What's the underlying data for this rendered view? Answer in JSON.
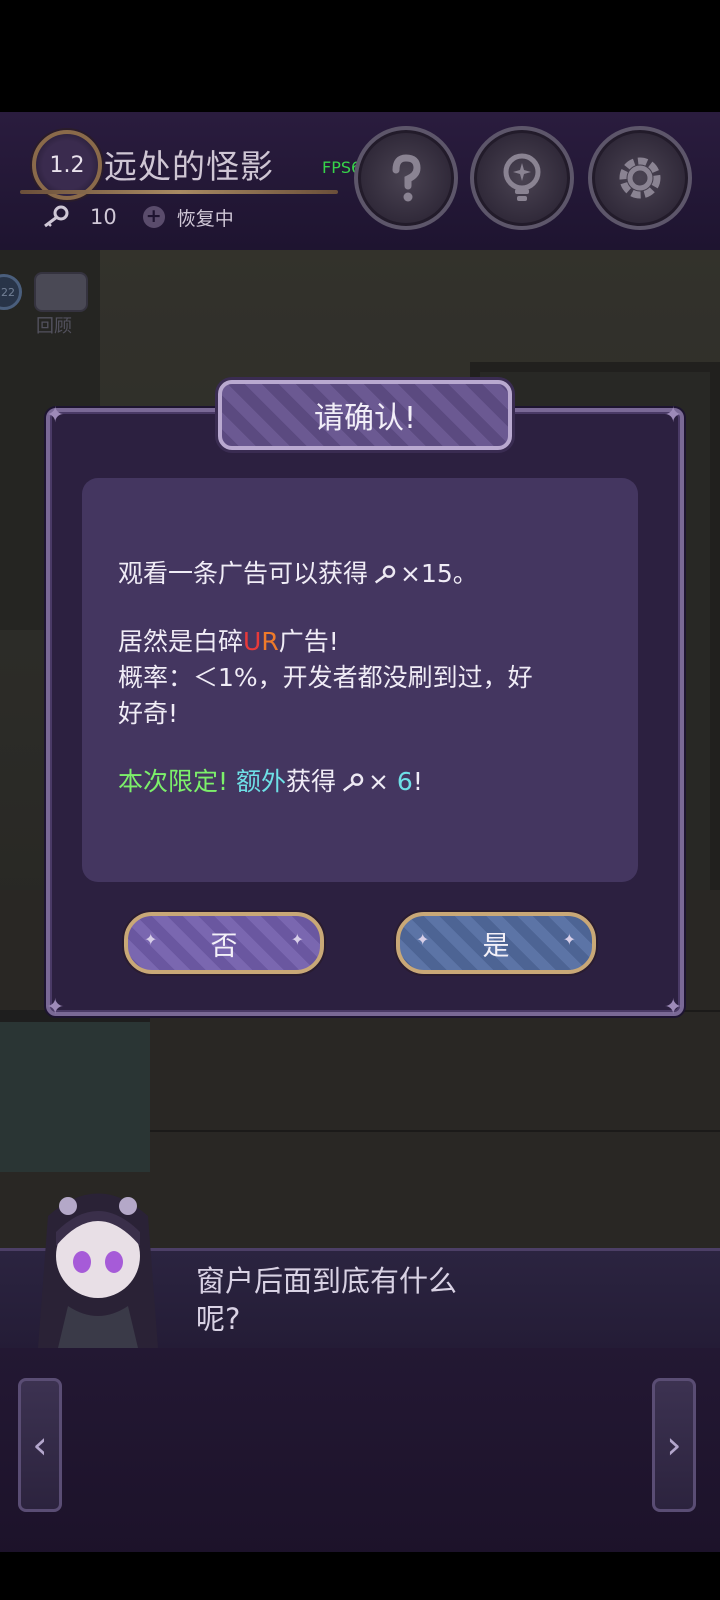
{
  "header": {
    "level": "1.2",
    "title": "远处的怪影",
    "fps": "FPS61",
    "keys": "10",
    "recover_label": "恢复中",
    "buttons": {
      "help_icon": "question-icon",
      "hint_icon": "bulb-icon",
      "settings_icon": "gear-icon"
    }
  },
  "scene": {
    "review_label": "回顾",
    "review_badge": "22"
  },
  "dialog": {
    "title": "请确认!",
    "line1_pre": "观看一条广告可以获得",
    "line1_post": "×15。",
    "line2_pre": "居然是白碎",
    "line2_u": "U",
    "line2_r": "R",
    "line2_post": "广告!",
    "line3": "概率：＜1%，开发者都没刷到过，好",
    "line4": "好奇!",
    "line5_green": "本次限定!",
    "line5_cyan": "额外",
    "line5_mid": "获得",
    "line5_x": "×",
    "line5_num": "6",
    "line5_end": "!",
    "no_label": "否",
    "yes_label": "是"
  },
  "dialogue": {
    "text": "窗户后面到底有什么\n呢?"
  },
  "nav": {
    "prev_icon": "chevron-left-icon",
    "next_icon": "chevron-right-icon"
  },
  "colors": {
    "ur_u": "#e83a3a",
    "ur_r": "#ef7a2a",
    "green": "#7cf06a",
    "cyan": "#6ee0e6",
    "fps": "#37d34a"
  }
}
